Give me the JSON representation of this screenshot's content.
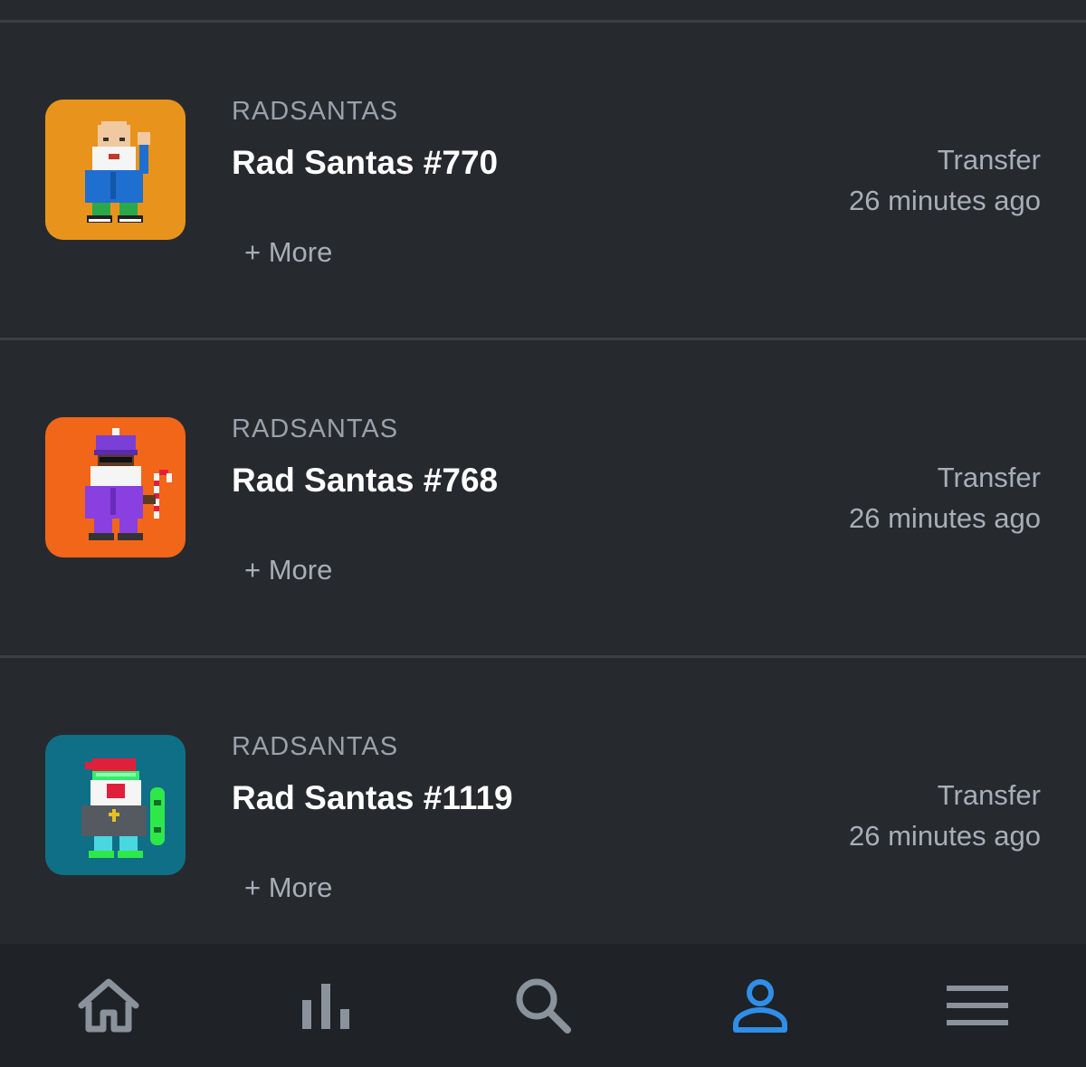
{
  "feed": {
    "items": [
      {
        "collection": "RADSANTAS",
        "title": "Rad Santas #770",
        "more_label": "+ More",
        "event": "Transfer",
        "time": "26 minutes ago",
        "thumb_bg": "#e8941c"
      },
      {
        "collection": "RADSANTAS",
        "title": "Rad Santas #768",
        "more_label": "+ More",
        "event": "Transfer",
        "time": "26 minutes ago",
        "thumb_bg": "#f2661a"
      },
      {
        "collection": "RADSANTAS",
        "title": "Rad Santas #1119",
        "more_label": "+ More",
        "event": "Transfer",
        "time": "26 minutes ago",
        "thumb_bg": "#0f6f86"
      }
    ]
  },
  "nav": {
    "items": [
      {
        "icon": "home-icon",
        "active": false
      },
      {
        "icon": "stats-icon",
        "active": false
      },
      {
        "icon": "search-icon",
        "active": false
      },
      {
        "icon": "profile-icon",
        "active": true
      },
      {
        "icon": "menu-icon",
        "active": false
      }
    ],
    "active_color": "#2f8ee8",
    "inactive_color": "#8a939b"
  }
}
